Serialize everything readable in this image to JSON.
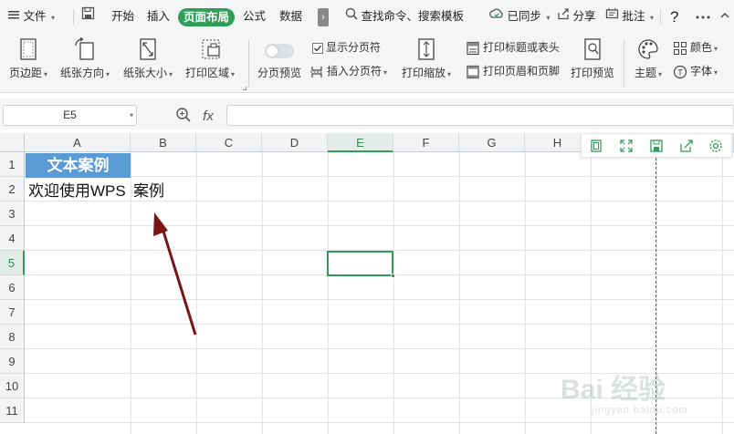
{
  "menubar": {
    "file": "文件",
    "tabs": [
      "开始",
      "插入",
      "页面布局",
      "公式",
      "数据"
    ],
    "active_tab": "页面布局",
    "more_glyph": "›",
    "search": "查找命令、搜索模板",
    "sync": "已同步",
    "share": "分享",
    "comment": "批注",
    "help": "?"
  },
  "ribbon": {
    "margins": "页边距",
    "orientation": "纸张方向",
    "size": "纸张大小",
    "print_area": "打印区域",
    "page_preview": "分页预览",
    "show_page_break": "显示分页符",
    "insert_page_break": "插入分页符",
    "print_scale": "打印缩放",
    "print_titles": "打印标题或表头",
    "header_footer": "打印页眉和页脚",
    "print_preview": "打印预览",
    "theme": "主题",
    "colors": "颜色",
    "fonts": "字体",
    "font_glyph": "T"
  },
  "formula_bar": {
    "name_box": "E5",
    "fx": "fx",
    "formula": ""
  },
  "sheet": {
    "columns": [
      "A",
      "B",
      "C",
      "D",
      "E",
      "F",
      "G",
      "H"
    ],
    "rows": [
      "1",
      "2",
      "3",
      "4",
      "5",
      "6",
      "7",
      "8",
      "9",
      "10",
      "11"
    ],
    "selected_column": "E",
    "selected_row": "5",
    "a1": "文本案例",
    "a2": "欢迎使用WPS",
    "b2": "案例"
  },
  "colors": {
    "accent": "#2f9e57",
    "header_fill": "#5b9bd5",
    "arrow": "#7a1515"
  },
  "watermark": {
    "brand": "Bai 经验",
    "url": "jingyan.baidu.com"
  }
}
